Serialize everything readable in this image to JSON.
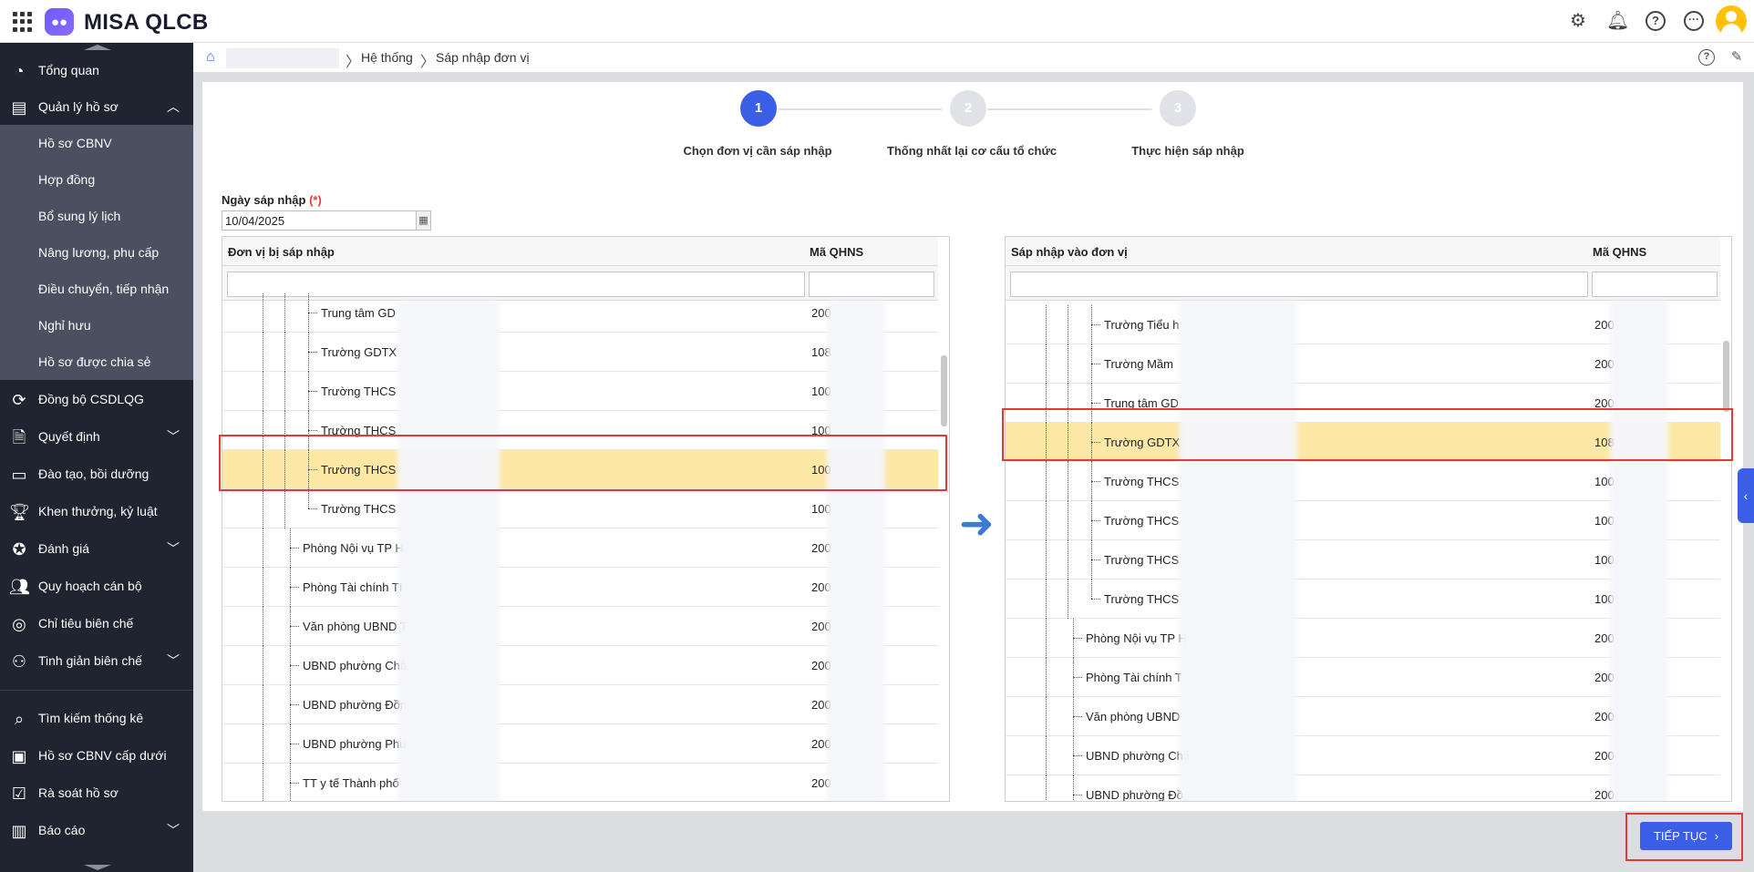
{
  "app": {
    "title": "MISA QLCB",
    "accent": "#3b5ee6"
  },
  "topbar": {
    "icons": [
      "apps-grid-icon",
      "settings-gear-icon",
      "bell-icon",
      "help-icon",
      "more-icon",
      "user-avatar"
    ]
  },
  "sidebar": {
    "items": [
      {
        "label": "Tổng quan",
        "icon": "pie-chart-icon"
      },
      {
        "label": "Quản lý hồ sơ",
        "icon": "profile-card-icon",
        "expanded": true
      },
      {
        "label": "Đồng bộ CSDLQG",
        "icon": "sync-icon"
      },
      {
        "label": "Quyết định",
        "icon": "document-icon",
        "expandable": true
      },
      {
        "label": "Đào tạo, bồi dưỡng",
        "icon": "training-icon"
      },
      {
        "label": "Khen thưởng, kỷ luật",
        "icon": "trophy-icon"
      },
      {
        "label": "Đánh giá",
        "icon": "medal-icon",
        "expandable": true
      },
      {
        "label": "Quy hoạch cán bộ",
        "icon": "users-icon"
      },
      {
        "label": "Chỉ tiêu biên chế",
        "icon": "target-icon"
      },
      {
        "label": "Tinh giản biên chế",
        "icon": "user-settings-icon",
        "expandable": true
      },
      {
        "label": "Tìm kiếm thống kê",
        "icon": "search-icon"
      },
      {
        "label": "Hồ sơ CBNV cấp dưới",
        "icon": "id-card-icon"
      },
      {
        "label": "Rà soát hồ sơ",
        "icon": "review-icon"
      },
      {
        "label": "Báo cáo",
        "icon": "report-icon",
        "expandable": true
      }
    ],
    "subitems": [
      "Hồ sơ CBNV",
      "Hợp đồng",
      "Bổ sung lý lịch",
      "Nâng lương, phụ cấp",
      "Điều chuyển, tiếp nhận",
      "Nghỉ hưu",
      "Hồ sơ được chia sẻ"
    ]
  },
  "breadcrumb": {
    "items": [
      "Hệ thống",
      "Sáp nhập đơn vị"
    ],
    "separator": "〉"
  },
  "stepper": {
    "steps": [
      {
        "number": "1",
        "label": "Chọn đơn vị cần sáp nhập",
        "active": true
      },
      {
        "number": "2",
        "label": "Thống nhất lại cơ cấu tổ chức",
        "active": false
      },
      {
        "number": "3",
        "label": "Thực hiện sáp nhập",
        "active": false
      }
    ]
  },
  "merge_date": {
    "label": "Ngày sáp nhập",
    "required_mark": "(*)",
    "value": "10/04/2025"
  },
  "left_grid": {
    "col_name": "Đơn vị bị sáp nhập",
    "col_code": "Mã QHNS",
    "rows": [
      {
        "name": "Trung tâm GD",
        "code": "200",
        "level": 3,
        "selected": false
      },
      {
        "name": "Trường GDTX",
        "code": "108",
        "level": 3,
        "selected": false
      },
      {
        "name": "Trường THCS",
        "code": "100",
        "level": 3,
        "selected": false
      },
      {
        "name": "Trường THCS",
        "code": "100",
        "level": 3,
        "selected": false
      },
      {
        "name": "Trường THCS",
        "code": "100",
        "level": 3,
        "selected": true
      },
      {
        "name": "Trường THCS",
        "code": "100",
        "level": 3,
        "selected": false,
        "last": true
      },
      {
        "name": "Phòng Nội vụ TP H",
        "code": "200",
        "level": 2,
        "selected": false
      },
      {
        "name": "Phòng Tài chính TI",
        "code": "200",
        "level": 2,
        "selected": false
      },
      {
        "name": "Văn phòng UBND T",
        "code": "200",
        "level": 2,
        "selected": false
      },
      {
        "name": "UBND phường Chả",
        "code": "200",
        "level": 2,
        "selected": false
      },
      {
        "name": "UBND phường Đồn",
        "code": "200",
        "level": 2,
        "selected": false
      },
      {
        "name": "UBND phường Phu",
        "code": "200",
        "level": 2,
        "selected": false
      },
      {
        "name": "TT y tế Thành phố",
        "code": "200",
        "level": 2,
        "selected": false
      }
    ]
  },
  "right_grid": {
    "col_name": "Sáp nhập vào đơn vị",
    "col_code": "Mã QHNS",
    "rows": [
      {
        "name": "Trường Tiểu h",
        "code": "200",
        "level": 3,
        "selected": false
      },
      {
        "name": "Trường Mầm",
        "code": "200",
        "level": 3,
        "selected": false
      },
      {
        "name": "Trung tâm GD",
        "code": "200",
        "level": 3,
        "selected": false
      },
      {
        "name": "Trường GDTX",
        "code": "108",
        "level": 3,
        "selected": true
      },
      {
        "name": "Trường THCS",
        "code": "100",
        "level": 3,
        "selected": false
      },
      {
        "name": "Trường THCS",
        "code": "100",
        "level": 3,
        "selected": false
      },
      {
        "name": "Trường THCS",
        "code": "100",
        "level": 3,
        "selected": false
      },
      {
        "name": "Trường THCS",
        "code": "100",
        "level": 3,
        "selected": false,
        "last": true
      },
      {
        "name": "Phòng Nội vụ TP H",
        "code": "200",
        "level": 2,
        "selected": false
      },
      {
        "name": "Phòng Tài chính T",
        "code": "200",
        "level": 2,
        "selected": false
      },
      {
        "name": "Văn phòng UBND",
        "code": "200",
        "level": 2,
        "selected": false
      },
      {
        "name": "UBND phường Chả",
        "code": "200",
        "level": 2,
        "selected": false
      },
      {
        "name": "UBND phường Đồ",
        "code": "200",
        "level": 2,
        "selected": false
      }
    ]
  },
  "actions": {
    "next_label": "TIẾP TỤC"
  }
}
